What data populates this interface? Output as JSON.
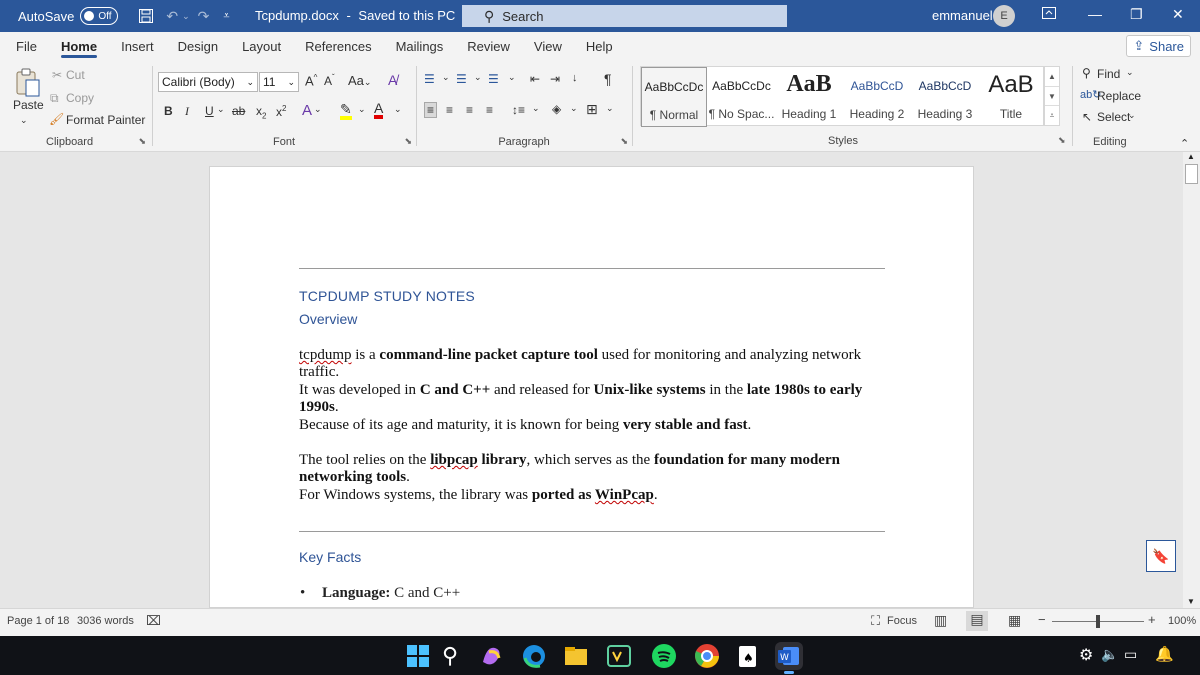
{
  "titlebar": {
    "autosave_label": "AutoSave",
    "autosave_state": "Off",
    "doc_name": "Tcpdump.docx",
    "separator": "-",
    "save_status": "Saved to this PC",
    "search_placeholder": "Search",
    "user_name": "emmanuel",
    "avatar_initial": "E",
    "accent": "#2b579a"
  },
  "menu": {
    "tabs": [
      "File",
      "Home",
      "Insert",
      "Design",
      "Layout",
      "References",
      "Mailings",
      "Review",
      "View",
      "Help"
    ],
    "active": "Home",
    "share_label": "Share"
  },
  "ribbon": {
    "clipboard": {
      "paste": "Paste",
      "cut": "Cut",
      "copy": "Copy",
      "format_painter": "Format Painter",
      "label": "Clipboard"
    },
    "font": {
      "name": "Calibri (Body)",
      "size": "11",
      "grow": "A",
      "shrink": "A",
      "case": "Aa",
      "bold": "B",
      "italic": "I",
      "underline": "U",
      "strike": "ab",
      "sub": "x",
      "sup": "x",
      "label": "Font"
    },
    "paragraph": {
      "label": "Paragraph"
    },
    "styles": {
      "items": [
        {
          "preview": "AaBbCcDc",
          "name": "¶ Normal"
        },
        {
          "preview": "AaBbCcDc",
          "name": "¶ No Spac..."
        },
        {
          "preview": "AaB",
          "name": "Heading 1"
        },
        {
          "preview": "AaBbCcD",
          "name": "Heading 2"
        },
        {
          "preview": "AaBbCcD",
          "name": "Heading 3"
        },
        {
          "preview": "AaB",
          "name": "Title"
        }
      ],
      "label": "Styles"
    },
    "editing": {
      "find": "Find",
      "replace": "Replace",
      "select": "Select",
      "label": "Editing"
    }
  },
  "document": {
    "title": "TCPDUMP STUDY NOTES",
    "subtitle": "Overview",
    "p1": {
      "a": "tcpdump",
      "b": " is a ",
      "c": "command-line packet capture tool",
      "d": " used for monitoring and analyzing network traffic."
    },
    "p2": {
      "a": "It was developed in ",
      "b": "C and C++",
      "c": " and released for ",
      "d": "Unix-like systems",
      "e": " in the ",
      "f": "late 1980s to early 1990s",
      "g": "."
    },
    "p3": {
      "a": "Because of its age and maturity, it is known for being ",
      "b": "very stable and fast",
      "c": "."
    },
    "p4": {
      "a": "The tool relies on the ",
      "b": "libpcap",
      "c": " library",
      "d": ", which serves as the ",
      "e": "foundation for many modern networking tools",
      "f": "."
    },
    "p5": {
      "a": "For Windows systems, the library was ",
      "b": "ported as ",
      "c": "WinPcap",
      "d": "."
    },
    "key_facts": "Key Facts",
    "bullet1_label": "Language:",
    "bullet1_value": " C and C++"
  },
  "status": {
    "page": "Page 1 of 18",
    "words": "3036 words",
    "focus": "Focus",
    "zoom": "100%"
  }
}
